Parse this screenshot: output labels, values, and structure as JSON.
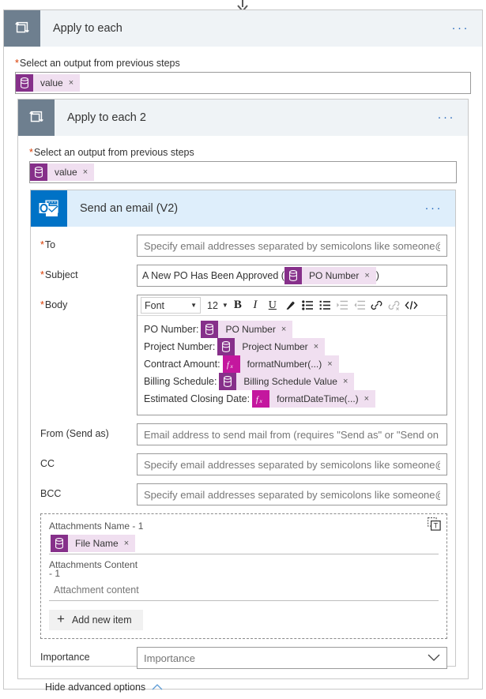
{
  "connector": {
    "icon": "arrow-down-icon"
  },
  "loop1": {
    "icon": "loop-icon",
    "title": "Apply to each",
    "menu": "···",
    "field_label": "Select an output from previous steps",
    "required_mark": "*",
    "token": {
      "icon": "dynamic-content-icon",
      "text": "value",
      "remove": "×"
    }
  },
  "loop2": {
    "icon": "loop-icon",
    "title": "Apply to each 2",
    "menu": "···",
    "field_label": "Select an output from previous steps",
    "required_mark": "*",
    "token": {
      "icon": "dynamic-content-icon",
      "text": "value",
      "remove": "×"
    }
  },
  "email": {
    "icon": "outlook-icon",
    "title": "Send an email (V2)",
    "menu": "···",
    "to": {
      "label": "To",
      "required_mark": "*",
      "placeholder": "Specify email addresses separated by semicolons like someone@contoso.com",
      "value": ""
    },
    "subject": {
      "label": "Subject",
      "required_mark": "*",
      "text_before": "A New PO Has Been Approved (",
      "token": {
        "icon": "dynamic-content-icon",
        "text": "PO Number",
        "remove": "×"
      },
      "text_after": ")"
    },
    "body": {
      "label": "Body",
      "required_mark": "*",
      "toolbar": {
        "font_label": "Font",
        "font_caret": "▼",
        "size_label": "12",
        "size_caret": "▼",
        "bold": "B",
        "italic": "I",
        "underline": "U",
        "buttons": [
          "bold-icon",
          "italic-icon",
          "underline-icon",
          "text-color-icon",
          "bulleted-list-icon",
          "numbered-list-icon",
          "indent-icon",
          "outdent-icon",
          "link-icon",
          "unlink-icon",
          "code-view-icon"
        ]
      },
      "lines": [
        {
          "label": "PO Number:",
          "token_icon": "dynamic-content-icon",
          "token_type": "dynamic",
          "token": "PO Number",
          "remove": "×",
          "indent": 0
        },
        {
          "label": "Project Number:",
          "token_icon": "dynamic-content-icon",
          "token_type": "dynamic",
          "token": "Project Number",
          "remove": "×",
          "indent": 0
        },
        {
          "label": "Contract Amount:",
          "token_icon": "expression-icon",
          "token_type": "expression",
          "token": "formatNumber(...)",
          "remove": "×",
          "indent": 0
        },
        {
          "label": "Billing Schedule:",
          "token_icon": "dynamic-content-icon",
          "token_type": "dynamic",
          "token": "Billing Schedule Value",
          "remove": "×",
          "indent": 0
        },
        {
          "label": "Estimated Closing Date:",
          "token_icon": "expression-icon",
          "token_type": "expression",
          "token": "formatDateTime(...)",
          "remove": "×",
          "indent": 0
        }
      ]
    },
    "from": {
      "label": "From (Send as)",
      "placeholder": "Email address to send mail from (requires \"Send as\" or \"Send on behalf of\" permissions)",
      "value": ""
    },
    "cc": {
      "label": "CC",
      "placeholder": "Specify email addresses separated by semicolons like someone@contoso.com",
      "value": ""
    },
    "bcc": {
      "label": "BCC",
      "placeholder": "Specify email addresses separated by semicolons like someone@contoso.com",
      "value": ""
    },
    "attachments": {
      "copy_icon": "duplicate-item-icon",
      "name_label": "Attachments Name - 1",
      "name_token": {
        "icon": "dynamic-content-icon",
        "text": "File Name",
        "remove": "×"
      },
      "content_label": "Attachments Content - 1",
      "content_placeholder": "Attachment content",
      "content_value": "",
      "add_new_label": "Add new item",
      "add_new_icon": "plus-icon"
    },
    "importance": {
      "label": "Importance",
      "placeholder": "Importance",
      "value": "",
      "caret_icon": "chevron-down-icon"
    },
    "advanced": {
      "label": "Hide advanced options",
      "caret_icon": "chevron-up-icon"
    }
  },
  "colors": {
    "loop_header_bg": "#eff3f6",
    "loop_icon_bg": "#6e7f8f",
    "email_header_bg": "#deeefb",
    "outlook_blue": "#0072c6",
    "token_icon": "#86308a",
    "token_bg": "#f0dff0",
    "expression_icon": "#c4179e",
    "required_red": "#d83b01",
    "menu_blue": "#2266bb",
    "chevron_blue": "#5b9bd5"
  }
}
